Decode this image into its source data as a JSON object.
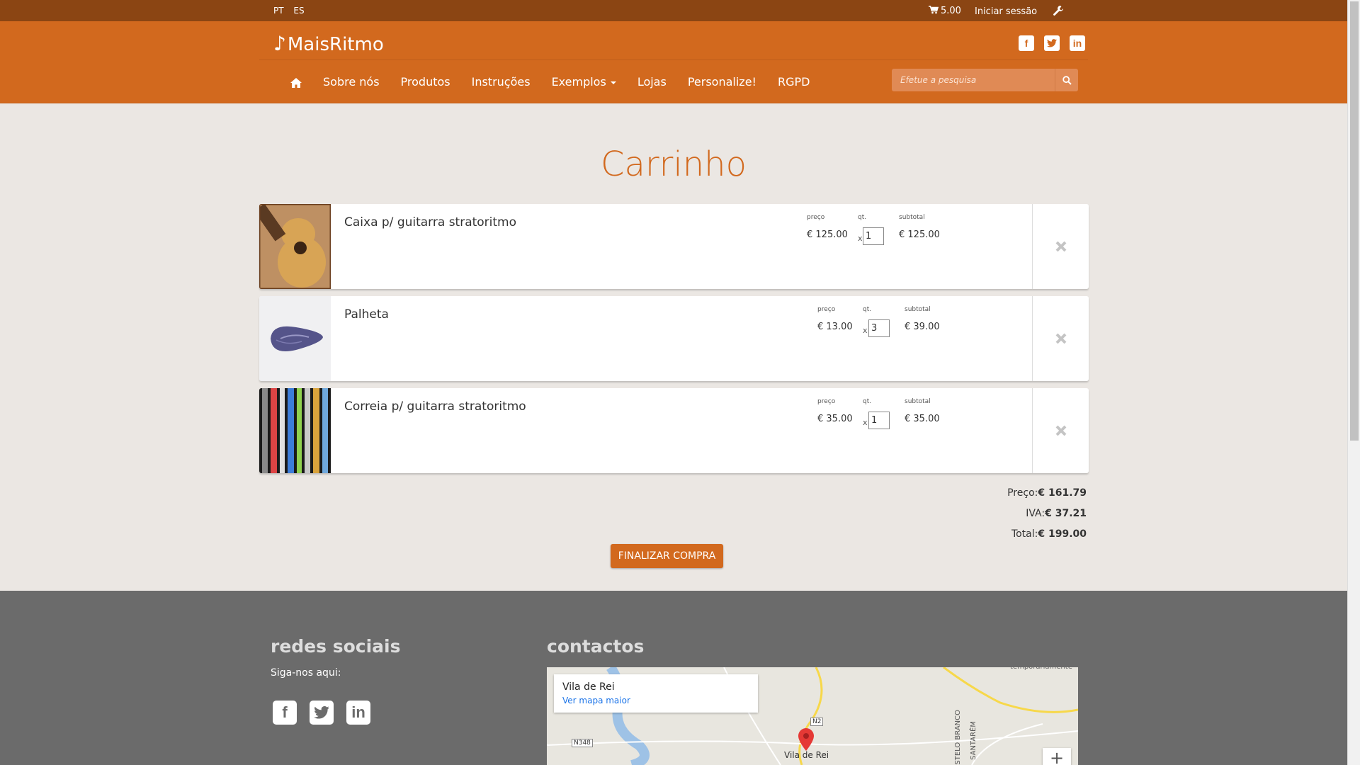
{
  "topbar": {
    "languages": [
      "PT",
      "ES"
    ],
    "cart_total": "5.00",
    "login_label": "Iniciar sessão"
  },
  "header": {
    "logo_text": "MaisRitmo",
    "social": [
      "facebook-icon",
      "twitter-icon",
      "linkedin-icon"
    ],
    "nav": {
      "about": "Sobre nós",
      "products": "Produtos",
      "instructions": "Instruções",
      "examples": "Exemplos",
      "stores": "Lojas",
      "customize": "Personalize!",
      "gdpr": "RGPD"
    },
    "search_placeholder": "Efetue a pesquisa"
  },
  "page_title": "Carrinho",
  "cart": {
    "labels": {
      "price": "preço",
      "qty": "qt.",
      "subtotal": "subtotal",
      "times": "x"
    },
    "items": [
      {
        "name": "Caixa p/ guitarra stratoritmo",
        "price": "€ 125.00",
        "qty": "1",
        "subtotal": "€ 125.00",
        "image": "acoustic-guitar-case"
      },
      {
        "name": "Palheta",
        "price": "€ 13.00",
        "qty": "3",
        "subtotal": "€ 39.00",
        "image": "guitar-pick"
      },
      {
        "name": "Correia p/ guitarra stratoritmo",
        "price": "€ 35.00",
        "qty": "1",
        "subtotal": "€ 35.00",
        "image": "guitar-straps"
      }
    ]
  },
  "totals": {
    "price_label": "Preço:",
    "price": "€ 161.79",
    "vat_label": "IVA:",
    "vat": "€ 37.21",
    "total_label": "Total:",
    "total": "€ 199.00"
  },
  "checkout_label": "FINALIZAR COMPRA",
  "footer": {
    "social_title": "redes sociais",
    "follow_text": "Siga-nos aqui:",
    "contacts_title": "contactos",
    "map": {
      "place": "Vila de Rei",
      "link": "Ver mapa maior",
      "town_label": "Vila de Rei",
      "road_n2": "N2",
      "road_n348": "N348",
      "top_text": "temporariamente",
      "vertical_1": "STELO BRANCO",
      "vertical_2": "SANTARÉM",
      "zoom_in": "+"
    }
  },
  "colors": {
    "brand": "#d2691e",
    "topbar": "#8b4513",
    "footer": "#6b6b6b"
  }
}
